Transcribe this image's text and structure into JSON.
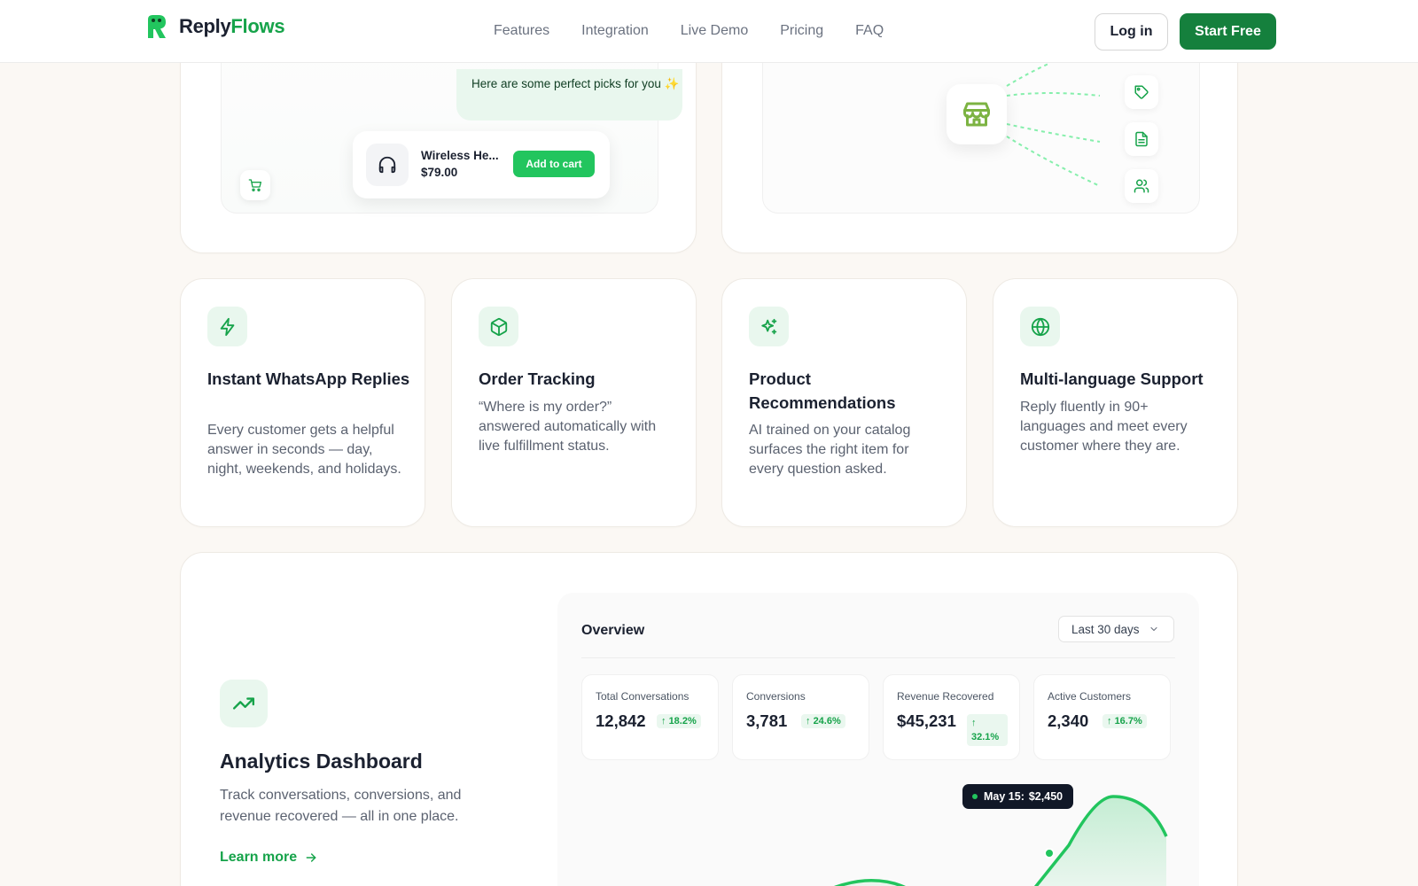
{
  "brand": {
    "name_part1": "Reply",
    "name_part2": "Flows",
    "accent": "#16a34a"
  },
  "nav": {
    "links": [
      "Features",
      "Integration",
      "Live Demo",
      "Pricing",
      "FAQ"
    ],
    "login": "Log in",
    "start": "Start Free"
  },
  "demo_chat": {
    "bubble": "Here are some perfect picks for you ✨",
    "product_name": "Wireless He...",
    "product_price": "$79.00",
    "add_to_cart": "Add to cart"
  },
  "features": [
    {
      "title": "Instant WhatsApp Replies",
      "desc": "Every customer gets a helpful answer in seconds — day, night, weekends, and holidays.",
      "icon": "lightning-icon"
    },
    {
      "title": "Order Tracking",
      "desc": "“Where is my order?” answered automatically with live fulfillment status.",
      "icon": "package-icon"
    },
    {
      "title": "Product Recommendations",
      "desc": "AI trained on your catalog surfaces the right item for every question asked.",
      "icon": "sparkles-icon"
    },
    {
      "title": "Multi-language Support",
      "desc": "Reply fluently in 90+ languages and meet every customer where they are.",
      "icon": "globe-icon"
    }
  ],
  "analytics": {
    "title": "Analytics Dashboard",
    "desc": "Track conversations, conversions, and revenue recovered — all in one place.",
    "link": "Learn more",
    "overview_title": "Overview",
    "range": "Last 30 days",
    "stats": [
      {
        "label": "Total Conversations",
        "value": "12,842",
        "change": "18.2%"
      },
      {
        "label": "Conversions",
        "value": "3,781",
        "change": "24.6%"
      },
      {
        "label": "Revenue Recovered",
        "value": "$45,231",
        "change": "32.1%"
      },
      {
        "label": "Active Customers",
        "value": "2,340",
        "change": "16.7%"
      }
    ],
    "tooltip_label": "May 15:",
    "tooltip_value": "$2,450"
  }
}
